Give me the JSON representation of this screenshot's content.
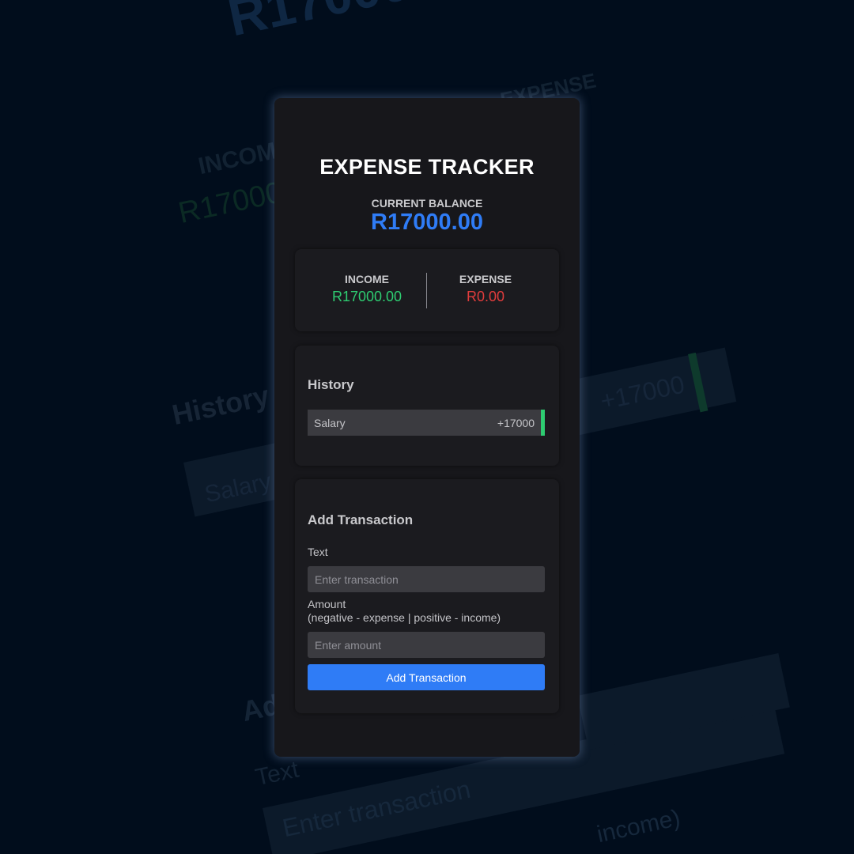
{
  "header": {
    "title": "EXPENSE TRACKER",
    "balance_label": "CURRENT BALANCE",
    "balance_value": "R17000.00"
  },
  "summary": {
    "income_label": "INCOME",
    "income_value": "R17000.00",
    "expense_label": "EXPENSE",
    "expense_value": "R0.00"
  },
  "history": {
    "title": "History",
    "items": [
      {
        "text": "Salary",
        "amount": "+17000",
        "type": "income"
      }
    ]
  },
  "add_transaction": {
    "title": "Add Transaction",
    "text_label": "Text",
    "text_placeholder": "Enter transaction",
    "amount_label": "Amount",
    "amount_hint": "(negative - expense | positive - income)",
    "amount_placeholder": "Enter amount",
    "button_label": "Add Transaction"
  },
  "colors": {
    "accent": "#2f7cf6",
    "income": "#2ecc71",
    "expense": "#e03c3c",
    "background": "#010d1c",
    "card": "#17171b"
  }
}
